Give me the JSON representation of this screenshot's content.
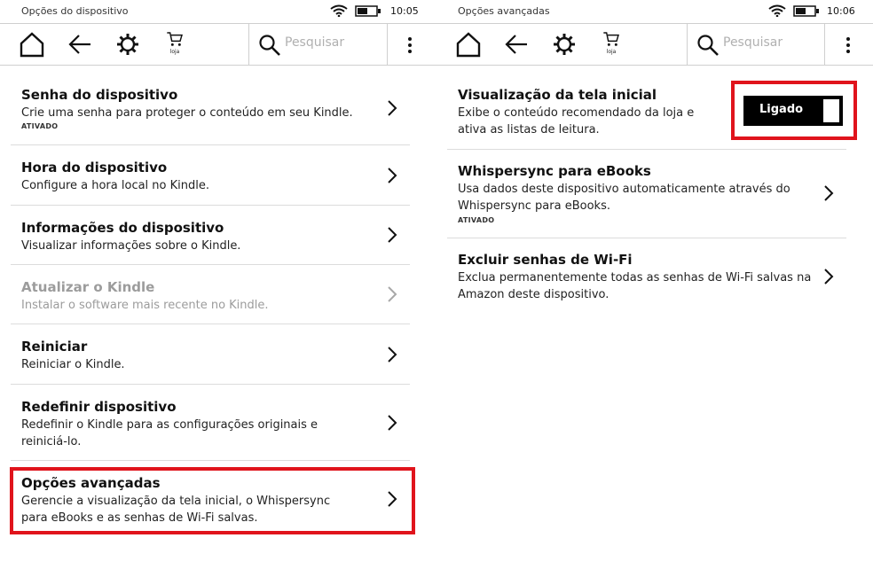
{
  "left": {
    "status": {
      "title": "Opções do dispositivo",
      "time": "10:05"
    },
    "toolbar": {
      "store_label": "loja",
      "search_placeholder": "Pesquisar"
    },
    "items": [
      {
        "title": "Senha do dispositivo",
        "desc": "Crie uma senha para proteger o conteúdo em seu Kindle.",
        "state": "ATIVADO"
      },
      {
        "title": "Hora do dispositivo",
        "desc": "Configure a hora local no Kindle."
      },
      {
        "title": "Informações do dispositivo",
        "desc": "Visualizar informações sobre o Kindle."
      },
      {
        "title": "Atualizar o Kindle",
        "desc": "Instalar o software mais recente no Kindle.",
        "disabled": true
      },
      {
        "title": "Reiniciar",
        "desc": "Reiniciar o Kindle."
      },
      {
        "title": "Redefinir dispositivo",
        "desc": "Redefinir o Kindle para as configurações originais e reiniciá-lo."
      },
      {
        "title": "Opções avançadas",
        "desc": "Gerencie a visualização da tela inicial, o Whispersync para eBooks e as senhas de Wi-Fi salvas."
      }
    ]
  },
  "right": {
    "status": {
      "title": "Opções avançadas",
      "time": "10:06"
    },
    "toolbar": {
      "store_label": "loja",
      "search_placeholder": "Pesquisar"
    },
    "items": [
      {
        "title": "Visualização da tela inicial",
        "desc": "Exibe o conteúdo recomendado da loja e ativa as listas de leitura.",
        "toggle": "Ligado"
      },
      {
        "title": "Whispersync para eBooks",
        "desc": "Usa dados deste dispositivo automaticamente através do Whispersync para eBooks.",
        "state": "ATIVADO"
      },
      {
        "title": "Excluir senhas de Wi-Fi",
        "desc": "Exclua permanentemente todas as senhas de Wi-Fi salvas na Amazon deste dispositivo."
      }
    ]
  },
  "colors": {
    "highlight": "#e0141c",
    "disabled_text": "#9c9c9c",
    "toggle_bg": "#000000"
  }
}
